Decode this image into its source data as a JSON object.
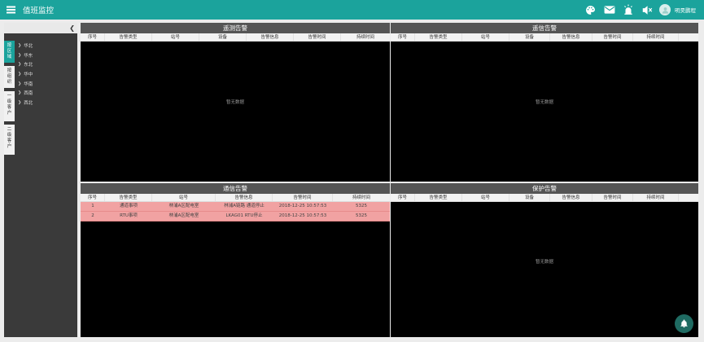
{
  "app": {
    "title": "值班监控"
  },
  "header": {
    "icons": [
      "palette-icon",
      "mail-icon",
      "alarm-light-icon",
      "mute-icon"
    ],
    "user": {
      "name": "明昊鹏程"
    }
  },
  "sidebar": {
    "tabs": [
      "按区域",
      "按组织",
      "一级客户",
      "二级客户"
    ],
    "regions": [
      "华北",
      "华东",
      "东北",
      "华中",
      "华南",
      "西南",
      "西北"
    ]
  },
  "panels": {
    "telemetry": {
      "title": "遥测告警",
      "columns": [
        "序号",
        "告警类型",
        "站号",
        "设备",
        "告警信息",
        "告警时间",
        "持续时间"
      ],
      "empty_text": "暂无数据"
    },
    "remote_signal": {
      "title": "遥信告警",
      "columns": [
        "序号",
        "告警类型",
        "站号",
        "设备",
        "告警信息",
        "告警时间",
        "持续时间"
      ],
      "empty_text": "暂无数据"
    },
    "communication": {
      "title": "通信告警",
      "columns": [
        "序号",
        "告警类型",
        "站号",
        "告警信息",
        "告警时间",
        "持续时间"
      ],
      "rows": [
        [
          "1",
          "通道事项",
          "林浦A区配电室",
          "林浦A链路 通道停止",
          "2018-12-25 10:57:53",
          "5325"
        ],
        [
          "2",
          "RTU事项",
          "林浦A区配电室",
          "LKAG01 RTU停止",
          "2018-12-25 10:57:53",
          "5325"
        ]
      ]
    },
    "protection": {
      "title": "保护告警",
      "columns": [
        "序号",
        "告警类型",
        "站号",
        "设备",
        "告警信息",
        "告警时间",
        "持续时间"
      ],
      "empty_text": "暂无数据"
    }
  },
  "colors": {
    "accent": "#1ba39c",
    "panel_header": "#555555",
    "alarm_row": "#f1a2a2"
  }
}
